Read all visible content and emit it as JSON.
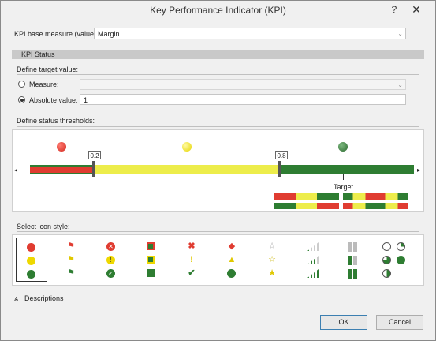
{
  "window": {
    "title": "Key Performance Indicator (KPI)",
    "help_glyph": "?",
    "close_glyph": "✕"
  },
  "base_measure": {
    "label": "KPI base measure (value):",
    "value": "Margin"
  },
  "kpi_status": {
    "header": "KPI Status",
    "define_target_label": "Define target value:",
    "measure_option": "Measure:",
    "measure_value": "",
    "absolute_option": "Absolute value:",
    "absolute_value": "1",
    "selected_option": "absolute"
  },
  "thresholds": {
    "label": "Define status thresholds:",
    "low_threshold": "0.2",
    "high_threshold": "0.8",
    "target_label": "Target",
    "colors": {
      "red": "#e03c31",
      "yellow": "#eded4b",
      "green": "#2e7d32"
    }
  },
  "icon_style": {
    "label": "Select icon style:",
    "selected_index": 0,
    "columns": [
      {
        "name": "circles",
        "icons": [
          "red-circle-icon",
          "yellow-circle-icon",
          "green-circle-icon"
        ]
      },
      {
        "name": "flags",
        "icons": [
          "red-flag-icon",
          "yellow-flag-icon",
          "green-flag-icon"
        ]
      },
      {
        "name": "symbols-circled",
        "icons": [
          "red-x-circle-icon",
          "yellow-exclamation-circle-icon",
          "green-check-circle-icon"
        ]
      },
      {
        "name": "squares",
        "icons": [
          "red-square-icon",
          "yellow-square-icon",
          "green-square-icon"
        ]
      },
      {
        "name": "symbols",
        "icons": [
          "red-x-icon",
          "yellow-exclamation-icon",
          "green-check-icon"
        ]
      },
      {
        "name": "shapes",
        "icons": [
          "red-diamond-icon",
          "yellow-triangle-icon",
          "green-circle-icon"
        ]
      },
      {
        "name": "stars",
        "icons": [
          "empty-star-icon",
          "half-star-icon",
          "full-star-icon"
        ]
      },
      {
        "name": "signal-bars",
        "icons": [
          "signal-low-icon",
          "signal-medium-icon",
          "signal-high-icon"
        ]
      },
      {
        "name": "boxes",
        "icons": [
          "boxes-low-icon",
          "boxes-medium-icon",
          "boxes-high-icon"
        ]
      },
      {
        "name": "quarters",
        "icons": [
          "quarter-empty-icon",
          "quarter-half-icon",
          "quarter-full-icon"
        ]
      }
    ]
  },
  "descriptions": {
    "label": "Descriptions",
    "expander_glyph": "⩓"
  },
  "buttons": {
    "ok": "OK",
    "cancel": "Cancel"
  }
}
